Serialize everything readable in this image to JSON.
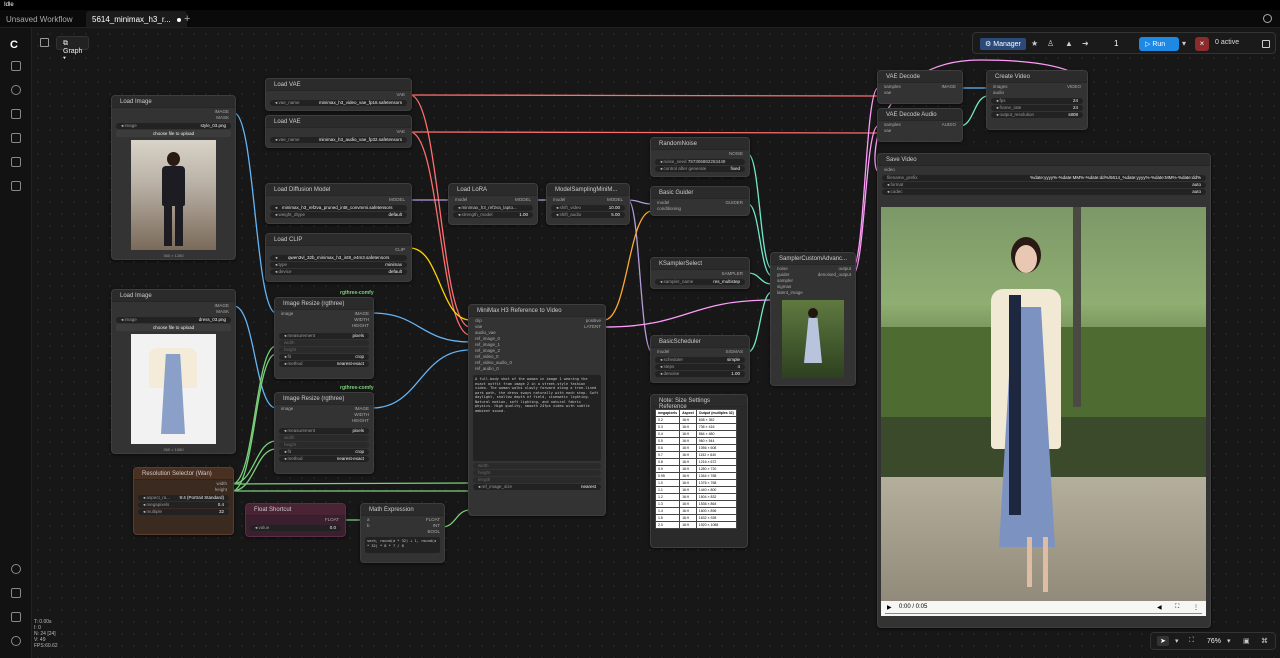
{
  "os_bar": {
    "label": "Idle"
  },
  "tabs": [
    {
      "label": "Unsaved Workflow"
    },
    {
      "label": "5614_minimax_h3_r..."
    }
  ],
  "graph_label": "Graph",
  "toolbar": {
    "manager": "Manager",
    "queue_count": "1",
    "run": "Run",
    "active": "0 active"
  },
  "zoom": "76%",
  "stats": [
    "T: 0.00s",
    "I: 0",
    "N: 24 [24]",
    "V: 49",
    "FPS:60.62"
  ],
  "nodes": {
    "load_image_1": {
      "title": "Load Image",
      "outs": [
        "IMAGE",
        "MASK"
      ],
      "image_key": "image",
      "image_val": "style_03.png",
      "upload": "choose file to upload",
      "caption": "360 × 1280"
    },
    "load_image_2": {
      "title": "Load Image",
      "outs": [
        "IMAGE",
        "MASK"
      ],
      "image_key": "image",
      "image_val": "dress_03.png",
      "upload": "choose file to upload",
      "caption": "360 × 1080"
    },
    "load_vae_1": {
      "title": "Load VAE",
      "out": "VAE",
      "k": "vae_name",
      "v": "minimax_h3_video_vae_fp16.safetensors"
    },
    "load_vae_2": {
      "title": "Load VAE",
      "out": "VAE",
      "k": "vae_name",
      "v": "minimax_h3_audio_vae_fp32.safetensors"
    },
    "load_diffusion": {
      "title": "Load Diffusion Model",
      "out": "MODEL",
      "w": [
        {
          "k": "",
          "v": "minimax_h3_ref2va_pruned_int8_convmmi.safetensors"
        },
        {
          "k": "weight_dtype",
          "v": "default"
        }
      ]
    },
    "load_clip": {
      "title": "Load CLIP",
      "out": "CLIP",
      "w": [
        {
          "k": "",
          "v": "qwen3vl_32b_minimax_h3_int8_e4m3.safetensors"
        },
        {
          "k": "type",
          "v": "minimax"
        },
        {
          "k": "device",
          "v": "default"
        }
      ]
    },
    "load_lora": {
      "title": "Load LoRA",
      "in": "model",
      "out": "MODEL",
      "w": [
        {
          "k": "",
          "v": "minimax_h3_ref2va_lapto..."
        },
        {
          "k": "strength_model",
          "v": "1.00"
        }
      ]
    },
    "model_sampling": {
      "title": "ModelSamplingMiniM...",
      "in": "model",
      "out": "MODEL",
      "w": [
        {
          "k": "shift_video",
          "v": "10.00"
        },
        {
          "k": "shift_audio",
          "v": "5.00"
        }
      ]
    },
    "random_noise": {
      "title": "RandomNoise",
      "out": "NOISE",
      "w": [
        {
          "k": "noise_seed",
          "v": "757306882253449"
        },
        {
          "k": "control after generate",
          "v": "fixed"
        }
      ]
    },
    "basic_guider": {
      "title": "Basic Guider",
      "ins": [
        "model",
        "conditioning"
      ],
      "out": "GUIDER"
    },
    "ksampler_select": {
      "title": "KSamplerSelect",
      "out": "SAMPLER",
      "w": [
        {
          "k": "sampler_name",
          "v": "res_multistep"
        }
      ]
    },
    "basic_scheduler": {
      "title": "BasicScheduler",
      "in": "model",
      "out": "SIGMAS",
      "w": [
        {
          "k": "scheduler",
          "v": "simple"
        },
        {
          "k": "steps",
          "v": "4"
        },
        {
          "k": "denoise",
          "v": "1.00"
        }
      ]
    },
    "sampler_custom": {
      "title": "SamplerCustomAdvanc...",
      "ins": [
        "noise",
        "guider",
        "sampler",
        "sigmas",
        "latent_image"
      ],
      "outs": [
        "output",
        "denoised_output"
      ]
    },
    "vae_decode": {
      "title": "VAE Decode",
      "ins": [
        "samples",
        "vae"
      ],
      "out": "IMAGE"
    },
    "vae_decode_audio": {
      "title": "VAE Decode Audio",
      "ins": [
        "samples",
        "vae"
      ],
      "out": "AUDIO"
    },
    "create_video": {
      "title": "Create Video",
      "ins": [
        "images",
        "audio"
      ],
      "out": "VIDEO",
      "w": [
        {
          "k": "fps",
          "v": "24"
        },
        {
          "k": "frame_rate",
          "v": "24"
        },
        {
          "k": "output_resolution",
          "v": "s808"
        }
      ]
    },
    "save_video": {
      "title": "Save Video",
      "in": "video",
      "w": [
        {
          "k": "filename_prefix",
          "v": "%date:yyyy%-%date:MM%-%date:dd%/5614_%date:yyyy%-%date:MM%-%date:dd%"
        },
        {
          "k": "format",
          "v": "auto"
        },
        {
          "k": "codec",
          "v": "auto"
        }
      ],
      "time": "0:00 / 0:05"
    },
    "resize_1": {
      "label": "rgthree-comfy",
      "title": "Image Resize (rgthree)",
      "in": "image",
      "outs": [
        "IMAGE",
        "WIDTH",
        "HEIGHT"
      ],
      "w": [
        {
          "k": "measurement",
          "v": "pixels"
        },
        {
          "k": "width",
          "v": ""
        },
        {
          "k": "height",
          "v": ""
        },
        {
          "k": "fit",
          "v": "crop"
        },
        {
          "k": "method",
          "v": "nearest-exact"
        }
      ]
    },
    "resize_2": {
      "label": "rgthree-comfy",
      "title": "Image Resize (rgthree)",
      "in": "image",
      "outs": [
        "IMAGE",
        "WIDTH",
        "HEIGHT"
      ],
      "w": [
        {
          "k": "measurement",
          "v": "pixels"
        },
        {
          "k": "width",
          "v": ""
        },
        {
          "k": "height",
          "v": ""
        },
        {
          "k": "fit",
          "v": "crop"
        },
        {
          "k": "method",
          "v": "nearest-exact"
        }
      ]
    },
    "minimax_ref": {
      "title": "MiniMax H3 Reference to Video",
      "ins": [
        "clip",
        "vae",
        "audio_vae",
        "ref_image_0",
        "ref_image_1",
        "ref_image_2",
        "ref_video_0",
        "ref_video_audio_0",
        "ref_audio_0"
      ],
      "outs": [
        "positive",
        "LATENT"
      ],
      "prompt": "A full-body shot of the woman in image 1 wearing the exact outfit from image 2 in a street-style fashion video. The woman walks slowly forward along a tree-lined park path, the dress sways naturally with each step. Soft daylight, shallow depth of field, cinematic lighting. Natural motion, soft lighting, and natural fabric physics. High quality, smooth 24fps video with subtle ambient sound.",
      "w": [
        {
          "k": "width",
          "v": ""
        },
        {
          "k": "height",
          "v": ""
        },
        {
          "k": "length",
          "v": ""
        },
        {
          "k": "ref_image_size",
          "v": "nearest"
        }
      ]
    },
    "resolution_selector": {
      "title": "Resolution Selector (Wan)",
      "outs": [
        "width",
        "height"
      ],
      "w": [
        {
          "k": "aspect_ra...",
          "v": "9:4 (Portrait Standard)"
        },
        {
          "k": "megapixels",
          "v": "0.4"
        },
        {
          "k": "multiple",
          "v": "32"
        }
      ]
    },
    "float_shortcut": {
      "title": "Float Shortcut",
      "out": "FLOAT",
      "w": [
        {
          "k": "value",
          "v": "0.0"
        }
      ]
    },
    "math_expr": {
      "title": "Math Expression",
      "ins": [
        "a",
        "b"
      ],
      "outs": [
        "FLOAT",
        "INT",
        "BOOL"
      ],
      "expr": "sech, round(a * 32) + 1, round(a * 32) * 8 * 7 / 8"
    },
    "ref_table": {
      "title": "Note: Size Settings Reference",
      "headers": [
        "megapixels",
        "Aspect",
        "Output (multiples 32)"
      ],
      "rows": [
        [
          "0.2",
          "16:9",
          "608 × 352"
        ],
        [
          "0.3",
          "16:9",
          "736 × 416"
        ],
        [
          "0.4",
          "16:9",
          "864 × 480"
        ],
        [
          "0.5",
          "16:9",
          "960 × 544"
        ],
        [
          "0.6",
          "16:9",
          "1056 × 608"
        ],
        [
          "0.7",
          "16:9",
          "1152 × 640"
        ],
        [
          "0.8",
          "16:9",
          "1216 × 672"
        ],
        [
          "0.9",
          "16:9",
          "1280 × 720"
        ],
        [
          "0.95",
          "16:9",
          "1344 × 768"
        ],
        [
          "1.0",
          "16:9",
          "1376 × 768"
        ],
        [
          "1.1",
          "16:9",
          "1440 × 800"
        ],
        [
          "1.2",
          "16:9",
          "1504 × 832"
        ],
        [
          "1.3",
          "16:9",
          "1536 × 864"
        ],
        [
          "1.4",
          "16:9",
          "1600 × 896"
        ],
        [
          "1.5",
          "16:9",
          "1632 × 928"
        ],
        [
          "2.0",
          "16:9",
          "1920 × 1088"
        ]
      ]
    }
  },
  "colors": {
    "vae": "#ff6e6e",
    "model": "#b39ddb",
    "clip": "#ffd500",
    "image": "#64b5f6",
    "latent": "#ff9cf9",
    "conditioning": "#ffa931",
    "int": "#7bd07b",
    "audio": "#71e8c7"
  }
}
